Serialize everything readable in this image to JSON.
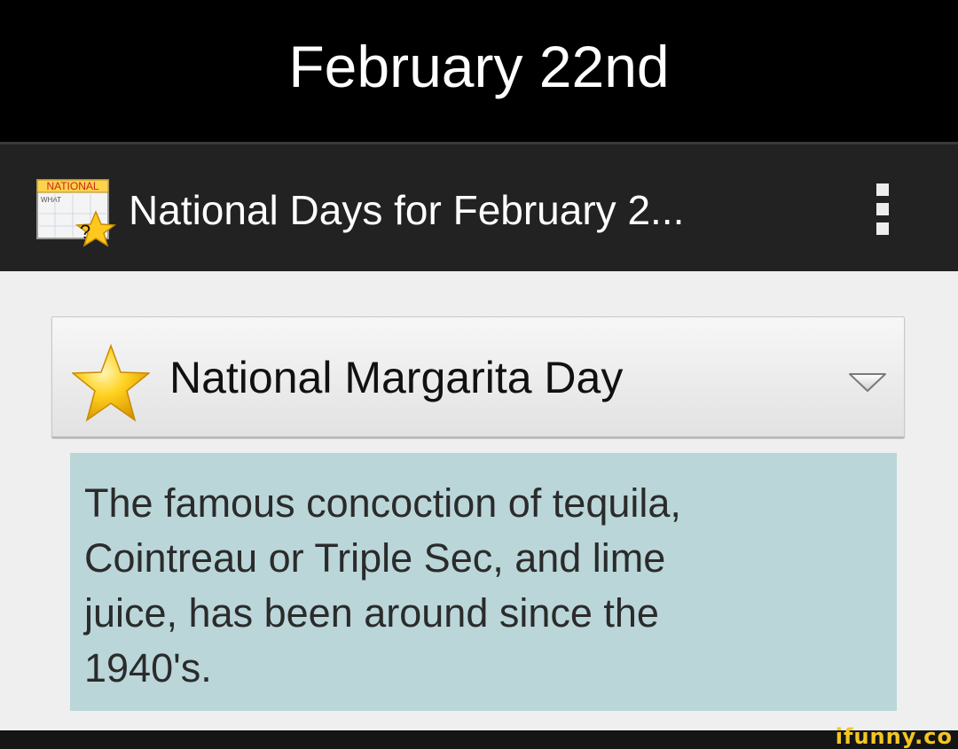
{
  "caption": {
    "title": "February 22nd"
  },
  "action_bar": {
    "app_icon": "national-day-calendar-icon",
    "app_icon_text": {
      "banner": "NATIONAL",
      "small": "WHAT",
      "mark": "?"
    },
    "title": "National Days for February 2...",
    "menu_icon": "overflow-menu-icon"
  },
  "day_selector": {
    "icon": "star-icon",
    "selected": "National Margarita Day",
    "chevron_icon": "chevron-down-icon"
  },
  "description": {
    "lines": [
      "The famous concoction of tequila,",
      "Cointreau or Triple Sec, and lime",
      "juice, has been around since the",
      "1940's."
    ]
  },
  "watermark": "ifunny.co",
  "colors": {
    "caption_bg": "#000000",
    "action_bar_bg": "#222222",
    "content_bg": "#efefef",
    "description_bg": "#bad6d9",
    "watermark": "#f3c623"
  }
}
